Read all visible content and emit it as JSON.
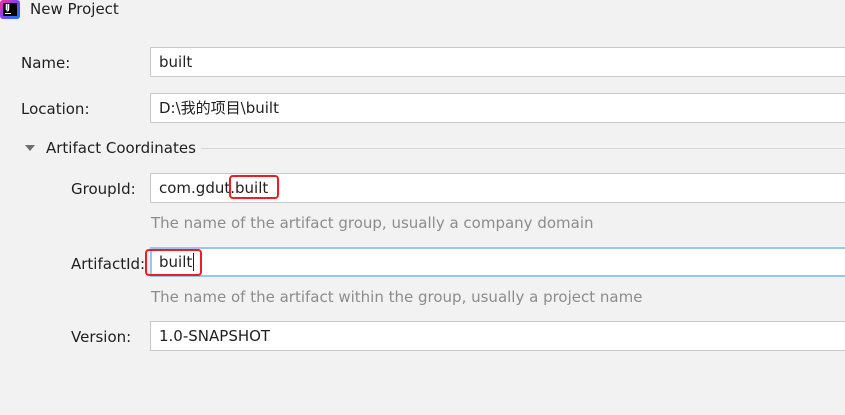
{
  "window": {
    "title": "New Project",
    "icon": "intellij-idea-icon",
    "icon_text": "IJ"
  },
  "fields": {
    "name": {
      "label": "Name:",
      "value": "built"
    },
    "location": {
      "label": "Location:",
      "value": "D:\\我的项目\\built"
    }
  },
  "artifact_coordinates": {
    "title": "Artifact Coordinates",
    "expanded": true,
    "group_id": {
      "label": "GroupId:",
      "value_prefix": "com.gdut.",
      "value_highlighted": "built",
      "hint": "The name of the artifact group, usually a company domain"
    },
    "artifact_id": {
      "label": "ArtifactId:",
      "value": "built",
      "hint": "The name of the artifact within the group, usually a project name",
      "focused": true
    },
    "version": {
      "label": "Version:",
      "value": "1.0-SNAPSHOT"
    }
  },
  "colors": {
    "background": "#f2f2f2",
    "field_border": "#c9c9c9",
    "focus_border": "#9bc4ee",
    "hint_text": "#8c8c8c",
    "annotation_highlight": "#ee1c24"
  }
}
